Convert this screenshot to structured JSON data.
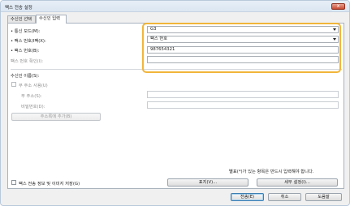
{
  "window": {
    "title": "팩스 전송 설정",
    "close_label": "x"
  },
  "tabs": [
    {
      "label": "수신인 선택",
      "active": false
    },
    {
      "label": "수신인 입력",
      "active": true
    }
  ],
  "form": {
    "comm_mode": {
      "label": "• 통신 모드(M):",
      "value": "G3"
    },
    "fax_format": {
      "label": "• 팩스 번호/I팩(X):",
      "value": "팩스 번호"
    },
    "fax_number": {
      "label": "• 팩스 번호(B):",
      "value": "987654321"
    },
    "fax_confirm": {
      "label": "팩스 번호 확인(I):",
      "value": ""
    }
  },
  "recipient": {
    "section_label": "수신인 이름(S):",
    "sub_address_checkbox": "부 주소 사용(U)",
    "sub_address_label": "부 주소(S):",
    "password_label": "비밀번호(D):",
    "add_address_book_button": "주소록에 추가(B)"
  },
  "footer": {
    "required_note": "별표(*)가 있는 항목은 반드시 입력해야 합니다.",
    "save_info_checkbox": "팩스 전송 정보 및 이미지 저장(G)",
    "cover_button": "표지(V)...",
    "detail_button": "세부 설정(I)...",
    "send_button": "전송(E)",
    "cancel_button": "취소",
    "help_button": "도움말"
  },
  "colors": {
    "highlight": "#f2b53a"
  }
}
